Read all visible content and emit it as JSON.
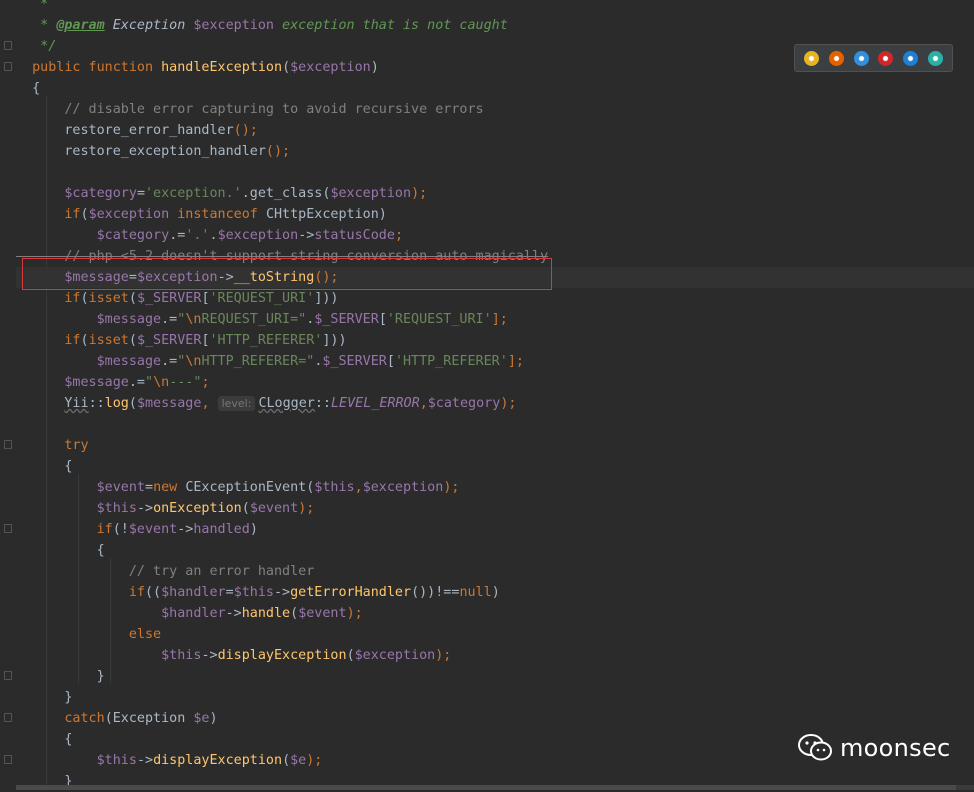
{
  "editor": {
    "lines": [
      {
        "tokens": [
          {
            "t": "   *",
            "c": "comment"
          }
        ]
      },
      {
        "tokens": [
          {
            "t": "   * ",
            "c": "comment"
          },
          {
            "t": "@param",
            "c": "doc-tag"
          },
          {
            "t": " Exception ",
            "c": "doc-type"
          },
          {
            "t": "$exception",
            "c": "var"
          },
          {
            "t": " exception that is not caught",
            "c": "comment"
          }
        ]
      },
      {
        "tokens": [
          {
            "t": "   */",
            "c": "comment"
          }
        ]
      },
      {
        "tokens": [
          {
            "t": "  ",
            "c": "plain"
          },
          {
            "t": "public function ",
            "c": "kw"
          },
          {
            "t": "handleException",
            "c": "fn"
          },
          {
            "t": "(",
            "c": "plain"
          },
          {
            "t": "$exception",
            "c": "var"
          },
          {
            "t": ")",
            "c": "plain"
          }
        ]
      },
      {
        "tokens": [
          {
            "t": "  {",
            "c": "plain"
          }
        ]
      },
      {
        "tokens": [
          {
            "t": "      // disable error capturing to avoid recursive errors",
            "c": "line-comment"
          }
        ]
      },
      {
        "tokens": [
          {
            "t": "      restore_error_handler",
            "c": "plain"
          },
          {
            "t": "();",
            "c": "kw"
          }
        ]
      },
      {
        "tokens": [
          {
            "t": "      restore_exception_handler",
            "c": "plain"
          },
          {
            "t": "();",
            "c": "kw"
          }
        ]
      },
      {
        "tokens": []
      },
      {
        "tokens": [
          {
            "t": "      ",
            "c": "plain"
          },
          {
            "t": "$category",
            "c": "var"
          },
          {
            "t": "=",
            "c": "plain"
          },
          {
            "t": "'exception.'",
            "c": "str"
          },
          {
            "t": ".get_class(",
            "c": "plain"
          },
          {
            "t": "$exception",
            "c": "var"
          },
          {
            "t": ");",
            "c": "kw"
          }
        ]
      },
      {
        "tokens": [
          {
            "t": "      ",
            "c": "plain"
          },
          {
            "t": "if",
            "c": "kw"
          },
          {
            "t": "(",
            "c": "plain"
          },
          {
            "t": "$exception",
            "c": "var"
          },
          {
            "t": " instanceof ",
            "c": "kw"
          },
          {
            "t": "CHttpException)",
            "c": "plain"
          }
        ]
      },
      {
        "tokens": [
          {
            "t": "          ",
            "c": "plain"
          },
          {
            "t": "$category",
            "c": "var"
          },
          {
            "t": ".=",
            "c": "plain"
          },
          {
            "t": "'.'",
            "c": "str"
          },
          {
            "t": ".",
            "c": "plain"
          },
          {
            "t": "$exception",
            "c": "var"
          },
          {
            "t": "->",
            "c": "plain"
          },
          {
            "t": "statusCode",
            "c": "var"
          },
          {
            "t": ";",
            "c": "kw"
          }
        ]
      },
      {
        "tokens": [
          {
            "t": "      // php <5.2 doesn't support string conversion auto-magically",
            "c": "line-comment",
            "x": "strike"
          }
        ]
      },
      {
        "tokens": [
          {
            "t": "      ",
            "c": "plain"
          },
          {
            "t": "$message",
            "c": "var"
          },
          {
            "t": "=",
            "c": "plain"
          },
          {
            "t": "$exception",
            "c": "var"
          },
          {
            "t": "->",
            "c": "plain"
          },
          {
            "t": "__toString",
            "c": "fn"
          },
          {
            "t": "();",
            "c": "kw"
          }
        ],
        "current": true
      },
      {
        "tokens": [
          {
            "t": "      ",
            "c": "plain"
          },
          {
            "t": "if",
            "c": "kw"
          },
          {
            "t": "(",
            "c": "plain"
          },
          {
            "t": "isset",
            "c": "kw"
          },
          {
            "t": "(",
            "c": "plain"
          },
          {
            "t": "$_SERVER",
            "c": "var"
          },
          {
            "t": "[",
            "c": "plain"
          },
          {
            "t": "'REQUEST_URI'",
            "c": "str"
          },
          {
            "t": "]))",
            "c": "plain"
          }
        ]
      },
      {
        "tokens": [
          {
            "t": "          ",
            "c": "plain"
          },
          {
            "t": "$message",
            "c": "var"
          },
          {
            "t": ".=",
            "c": "plain"
          },
          {
            "t": "\"",
            "c": "str"
          },
          {
            "t": "\\n",
            "c": "esc"
          },
          {
            "t": "REQUEST_URI=\"",
            "c": "str"
          },
          {
            "t": ".",
            "c": "plain"
          },
          {
            "t": "$_SERVER",
            "c": "var"
          },
          {
            "t": "[",
            "c": "plain"
          },
          {
            "t": "'REQUEST_URI'",
            "c": "str"
          },
          {
            "t": "];",
            "c": "kw"
          }
        ]
      },
      {
        "tokens": [
          {
            "t": "      ",
            "c": "plain"
          },
          {
            "t": "if",
            "c": "kw"
          },
          {
            "t": "(",
            "c": "plain"
          },
          {
            "t": "isset",
            "c": "kw"
          },
          {
            "t": "(",
            "c": "plain"
          },
          {
            "t": "$_SERVER",
            "c": "var"
          },
          {
            "t": "[",
            "c": "plain"
          },
          {
            "t": "'HTTP_REFERER'",
            "c": "str"
          },
          {
            "t": "]))",
            "c": "plain"
          }
        ]
      },
      {
        "tokens": [
          {
            "t": "          ",
            "c": "plain"
          },
          {
            "t": "$message",
            "c": "var"
          },
          {
            "t": ".=",
            "c": "plain"
          },
          {
            "t": "\"",
            "c": "str"
          },
          {
            "t": "\\n",
            "c": "esc"
          },
          {
            "t": "HTTP_REFERER=\"",
            "c": "str"
          },
          {
            "t": ".",
            "c": "plain"
          },
          {
            "t": "$_SERVER",
            "c": "var"
          },
          {
            "t": "[",
            "c": "plain"
          },
          {
            "t": "'HTTP_REFERER'",
            "c": "str"
          },
          {
            "t": "];",
            "c": "kw"
          }
        ]
      },
      {
        "tokens": [
          {
            "t": "      ",
            "c": "plain"
          },
          {
            "t": "$message",
            "c": "var"
          },
          {
            "t": ".=",
            "c": "plain"
          },
          {
            "t": "\"",
            "c": "str"
          },
          {
            "t": "\\n",
            "c": "esc"
          },
          {
            "t": "---\"",
            "c": "str"
          },
          {
            "t": ";",
            "c": "kw"
          }
        ]
      },
      {
        "tokens": [
          {
            "t": "      ",
            "c": "plain"
          },
          {
            "t": "Yii",
            "c": "plain",
            "x": "squiggle"
          },
          {
            "t": "::",
            "c": "plain"
          },
          {
            "t": "log",
            "c": "fn"
          },
          {
            "t": "(",
            "c": "plain"
          },
          {
            "t": "$message",
            "c": "var"
          },
          {
            "t": ", ",
            "c": "kw"
          },
          {
            "t": "level:",
            "c": "hint"
          },
          {
            "t": "CLogger",
            "c": "plain",
            "x": "squiggle"
          },
          {
            "t": "::",
            "c": "plain"
          },
          {
            "t": "LEVEL_ERROR",
            "c": "const"
          },
          {
            "t": ",",
            "c": "kw"
          },
          {
            "t": "$category",
            "c": "var"
          },
          {
            "t": ");",
            "c": "kw"
          }
        ]
      },
      {
        "tokens": []
      },
      {
        "tokens": [
          {
            "t": "      ",
            "c": "plain"
          },
          {
            "t": "try",
            "c": "kw"
          }
        ]
      },
      {
        "tokens": [
          {
            "t": "      {",
            "c": "plain"
          }
        ]
      },
      {
        "tokens": [
          {
            "t": "          ",
            "c": "plain"
          },
          {
            "t": "$event",
            "c": "var"
          },
          {
            "t": "=",
            "c": "plain"
          },
          {
            "t": "new ",
            "c": "kw"
          },
          {
            "t": "CExceptionEvent(",
            "c": "plain"
          },
          {
            "t": "$this",
            "c": "var"
          },
          {
            "t": ",",
            "c": "kw"
          },
          {
            "t": "$exception",
            "c": "var"
          },
          {
            "t": ");",
            "c": "kw"
          }
        ]
      },
      {
        "tokens": [
          {
            "t": "          ",
            "c": "plain"
          },
          {
            "t": "$this",
            "c": "var"
          },
          {
            "t": "->",
            "c": "plain"
          },
          {
            "t": "onException",
            "c": "fn"
          },
          {
            "t": "(",
            "c": "plain"
          },
          {
            "t": "$event",
            "c": "var"
          },
          {
            "t": ");",
            "c": "kw"
          }
        ]
      },
      {
        "tokens": [
          {
            "t": "          ",
            "c": "plain"
          },
          {
            "t": "if",
            "c": "kw"
          },
          {
            "t": "(!",
            "c": "plain"
          },
          {
            "t": "$event",
            "c": "var"
          },
          {
            "t": "->",
            "c": "plain"
          },
          {
            "t": "handled",
            "c": "var"
          },
          {
            "t": ")",
            "c": "plain"
          }
        ]
      },
      {
        "tokens": [
          {
            "t": "          {",
            "c": "plain"
          }
        ]
      },
      {
        "tokens": [
          {
            "t": "              // try an error handler",
            "c": "line-comment"
          }
        ]
      },
      {
        "tokens": [
          {
            "t": "              ",
            "c": "plain"
          },
          {
            "t": "if",
            "c": "kw"
          },
          {
            "t": "((",
            "c": "plain"
          },
          {
            "t": "$handler",
            "c": "var"
          },
          {
            "t": "=",
            "c": "plain"
          },
          {
            "t": "$this",
            "c": "var"
          },
          {
            "t": "->",
            "c": "plain"
          },
          {
            "t": "getErrorHandler",
            "c": "fn"
          },
          {
            "t": "())!==",
            "c": "plain"
          },
          {
            "t": "null",
            "c": "kw"
          },
          {
            "t": ")",
            "c": "plain"
          }
        ]
      },
      {
        "tokens": [
          {
            "t": "                  ",
            "c": "plain"
          },
          {
            "t": "$handler",
            "c": "var"
          },
          {
            "t": "->",
            "c": "plain"
          },
          {
            "t": "handle",
            "c": "fn"
          },
          {
            "t": "(",
            "c": "plain"
          },
          {
            "t": "$event",
            "c": "var"
          },
          {
            "t": ");",
            "c": "kw"
          }
        ]
      },
      {
        "tokens": [
          {
            "t": "              ",
            "c": "plain"
          },
          {
            "t": "else",
            "c": "kw"
          }
        ]
      },
      {
        "tokens": [
          {
            "t": "                  ",
            "c": "plain"
          },
          {
            "t": "$this",
            "c": "var"
          },
          {
            "t": "->",
            "c": "plain"
          },
          {
            "t": "displayException",
            "c": "fn"
          },
          {
            "t": "(",
            "c": "plain"
          },
          {
            "t": "$exception",
            "c": "var"
          },
          {
            "t": ");",
            "c": "kw"
          }
        ]
      },
      {
        "tokens": [
          {
            "t": "          }",
            "c": "plain"
          }
        ]
      },
      {
        "tokens": [
          {
            "t": "      }",
            "c": "plain"
          }
        ]
      },
      {
        "tokens": [
          {
            "t": "      ",
            "c": "plain"
          },
          {
            "t": "catch",
            "c": "kw"
          },
          {
            "t": "(Exception ",
            "c": "plain"
          },
          {
            "t": "$e",
            "c": "var"
          },
          {
            "t": ")",
            "c": "plain"
          }
        ]
      },
      {
        "tokens": [
          {
            "t": "      {",
            "c": "plain"
          }
        ]
      },
      {
        "tokens": [
          {
            "t": "          ",
            "c": "plain"
          },
          {
            "t": "$this",
            "c": "var"
          },
          {
            "t": "->",
            "c": "plain"
          },
          {
            "t": "displayException",
            "c": "fn"
          },
          {
            "t": "(",
            "c": "plain"
          },
          {
            "t": "$e",
            "c": "var"
          },
          {
            "t": ");",
            "c": "kw"
          }
        ]
      },
      {
        "tokens": [
          {
            "t": "      }",
            "c": "plain"
          }
        ]
      }
    ]
  },
  "browser_icons": [
    {
      "name": "chrome-icon",
      "color": "#e8b321"
    },
    {
      "name": "firefox-icon",
      "color": "#e66000"
    },
    {
      "name": "safari-icon",
      "color": "#2f8fe0"
    },
    {
      "name": "opera-icon",
      "color": "#d0262c"
    },
    {
      "name": "ie-icon",
      "color": "#1f7fd4"
    },
    {
      "name": "edge-icon",
      "color": "#2bb0a6"
    }
  ],
  "watermark": {
    "text": "moonsec"
  }
}
